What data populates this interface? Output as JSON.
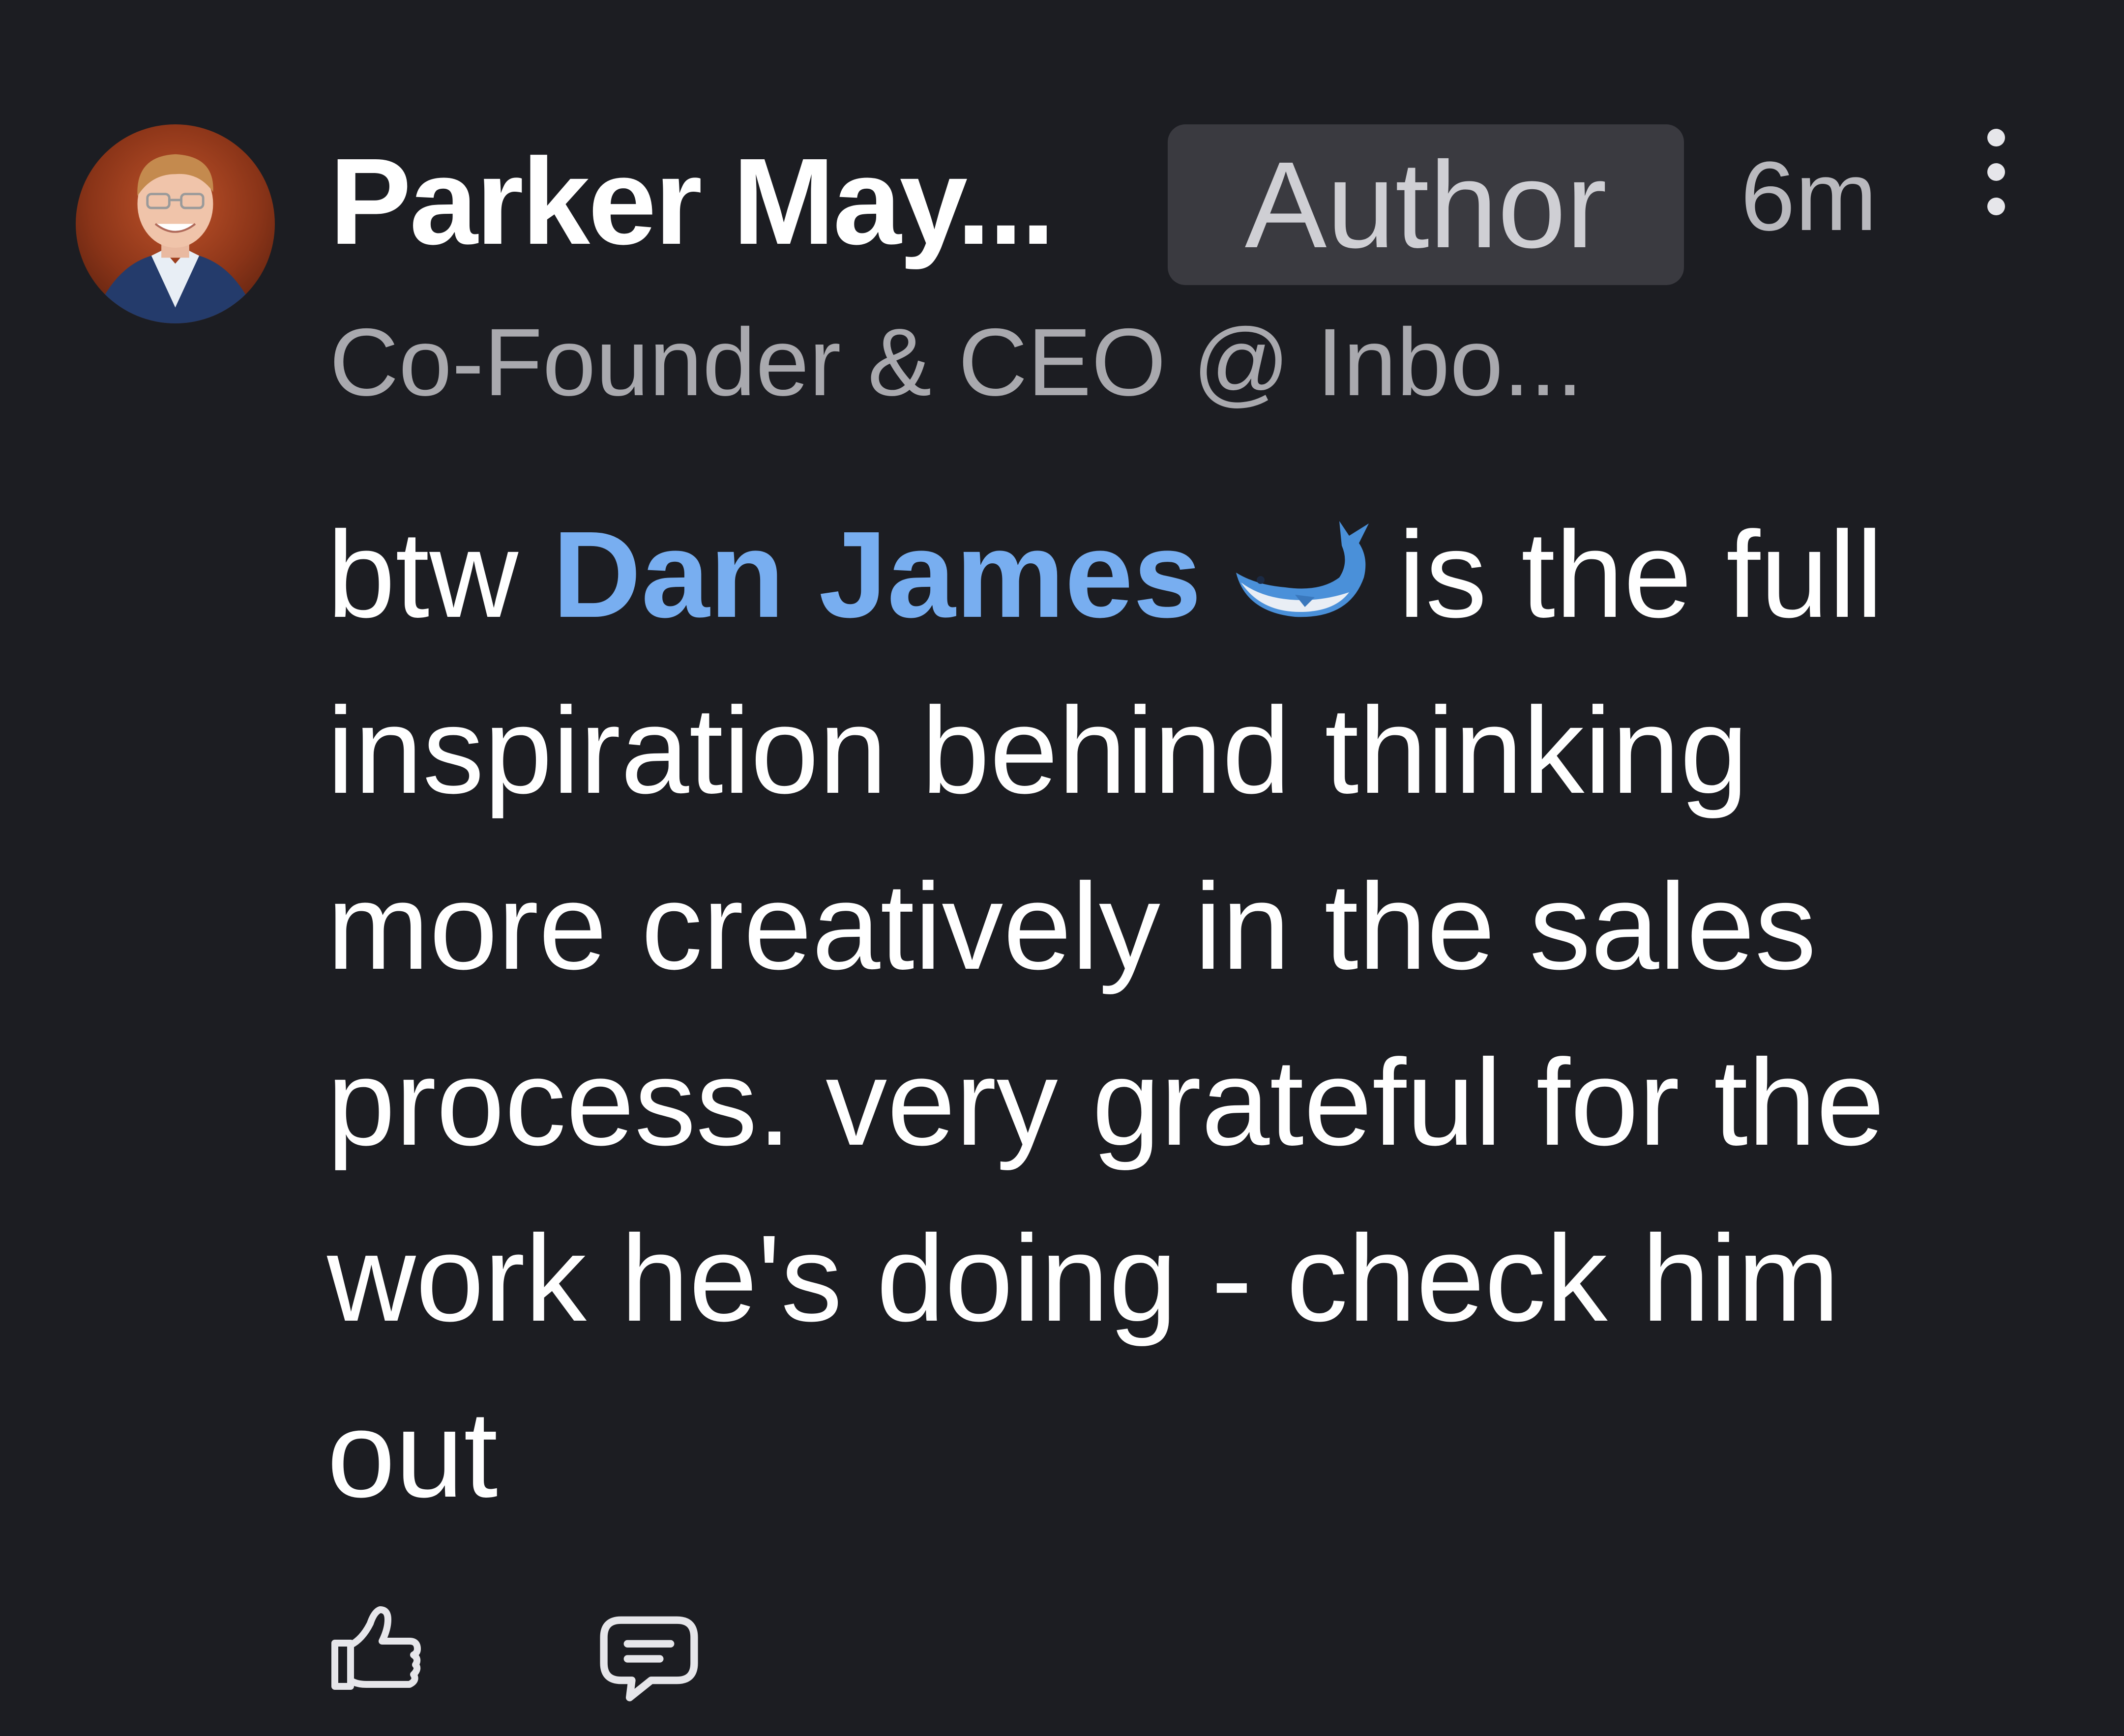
{
  "comment": {
    "author": {
      "name": "Parker May...",
      "badge": "Author",
      "headline": "Co-Founder & CEO @ Inbo..."
    },
    "timestamp": "6m",
    "body": {
      "prefix": "btw ",
      "mention": "Dan James",
      "mention_emoji_icon": "whale-emoji-icon",
      "suffix": "is the full inspiration behind thinking more creatively in the sales process. very grateful for the work he's doing - check him out"
    },
    "actions": {
      "like_icon": "thumbs-up-icon",
      "reply_icon": "comment-icon",
      "more_icon": "vertical-ellipsis-icon"
    }
  },
  "colors": {
    "background": "#1c1d22",
    "text": "#ffffff",
    "muted_text": "#a9a9ae",
    "mention": "#78aef0",
    "badge_bg": "#3a3a40",
    "badge_text": "#cfcfd4"
  }
}
